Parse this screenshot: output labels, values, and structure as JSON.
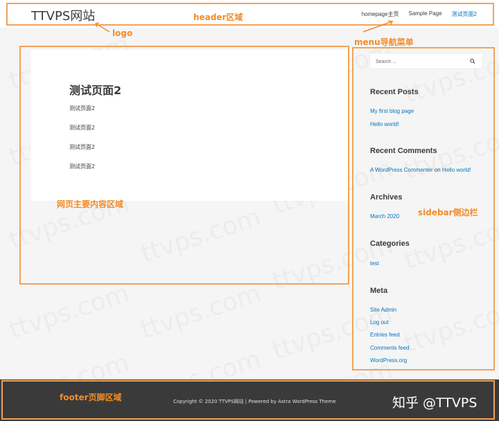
{
  "header": {
    "logo": "TTVPS网站",
    "menu": [
      {
        "label": "homepage主页",
        "current": false
      },
      {
        "label": "Sample Page",
        "current": false
      },
      {
        "label": "测试页面2",
        "current": true
      }
    ]
  },
  "content": {
    "title": "测试页面2",
    "lines": [
      "测试页面2",
      "测试页面2",
      "测试页面2",
      "测试页面2"
    ]
  },
  "sidebar": {
    "search_placeholder": "Search ...",
    "recent_posts": {
      "title": "Recent Posts",
      "items": [
        "My first blog page",
        "Hello world!"
      ]
    },
    "recent_comments": {
      "title": "Recent Comments",
      "author": "A WordPress Commenter",
      "joiner": "on",
      "post": "Hello world!"
    },
    "archives": {
      "title": "Archives",
      "items": [
        "March 2020"
      ]
    },
    "categories": {
      "title": "Categories",
      "items": [
        "test"
      ]
    },
    "meta": {
      "title": "Meta",
      "items": [
        "Site Admin",
        "Log out",
        "Entries feed",
        "Comments feed",
        "WordPress.org"
      ]
    }
  },
  "footer": {
    "copyright": "Copyright © 2020 TTVPS网站 | Powered by Astra WordPress Theme",
    "mark": "知乎 @TTVPS"
  },
  "annotations": {
    "header": "header区域",
    "logo": "logo",
    "menu": "menu导航菜单",
    "content": "网页主要内容区域",
    "sidebar": "sidebar侧边栏",
    "footer": "footer页脚区域"
  },
  "watermark": "ttvps.com",
  "colors": {
    "annotation": "#f28c28",
    "link": "#0274be",
    "footer_bg": "#3a3a3a",
    "page_bg": "#f5f5f5"
  }
}
